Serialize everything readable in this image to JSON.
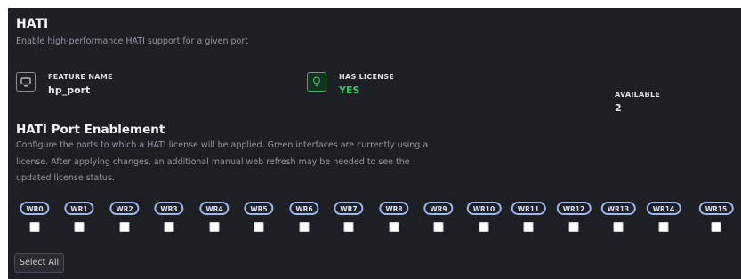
{
  "header": {
    "title": "HATI",
    "subtitle": "Enable high-performance HATI support for a given port"
  },
  "feature": {
    "icon": "monitor-icon",
    "label": "FEATURE NAME",
    "value": "hp_port"
  },
  "license": {
    "icon": "lightbulb-icon",
    "label": "HAS LICENSE",
    "value": "YES",
    "color": "#31c46a"
  },
  "available": {
    "label": "AVAILABLE",
    "value": "2"
  },
  "enablement": {
    "title": "HATI Port Enablement",
    "description": "Configure the ports to which a HATI license will be applied. Green interfaces are currently using a license. After applying changes, an additional manual web refresh may be needed to see the updated license status."
  },
  "ports": [
    "WR0",
    "WR1",
    "WR2",
    "WR3",
    "WR4",
    "WR5",
    "WR6",
    "WR7",
    "WR8",
    "WR9",
    "WR10",
    "WR11",
    "WR12",
    "WR13",
    "WR14",
    "WR15"
  ],
  "actions": {
    "select_all": "Select All"
  },
  "colors": {
    "panel_bg": "#1e1f24",
    "port_chip_border": "#9eb8ea",
    "license_green": "#31c46a"
  }
}
